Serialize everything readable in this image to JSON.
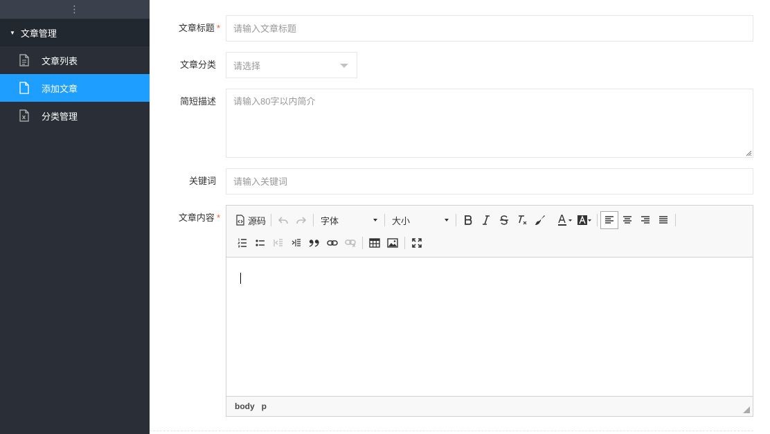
{
  "sidebar": {
    "toggle_glyph": "⋮",
    "group": {
      "label": "文章管理",
      "caret": "▼",
      "expanded": true
    },
    "items": [
      {
        "label": "文章列表",
        "icon": "document-lines-icon",
        "active": false
      },
      {
        "label": "添加文章",
        "icon": "document-blank-icon",
        "active": true
      },
      {
        "label": "分类管理",
        "icon": "document-x-icon",
        "active": false
      }
    ],
    "colors": {
      "background": "#2a2f37",
      "active": "#1e9fff"
    }
  },
  "form": {
    "title": {
      "label": "文章标题",
      "required_mark": "*",
      "placeholder": "请输入文章标题",
      "value": ""
    },
    "category": {
      "label": "文章分类",
      "selected": "请选择"
    },
    "description": {
      "label": "简短描述",
      "placeholder": "请输入80字以内简介",
      "value": ""
    },
    "keywords": {
      "label": "关键词",
      "placeholder": "请输入关键词",
      "value": ""
    },
    "content": {
      "label": "文章内容",
      "required_mark": "*"
    }
  },
  "editor": {
    "source_label": "源码",
    "font_label": "字体",
    "size_label": "大小",
    "status_path": [
      "body",
      "p"
    ]
  }
}
